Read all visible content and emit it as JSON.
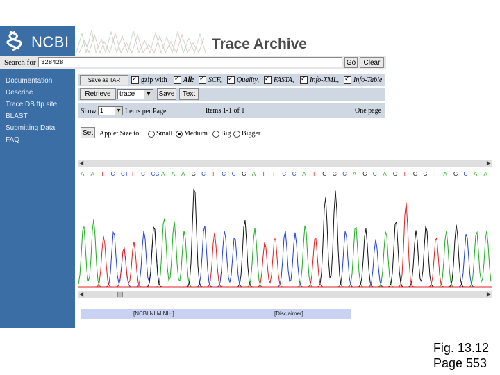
{
  "header": {
    "logo_text": "NCBI",
    "title": "Trace Archive"
  },
  "search": {
    "label": "Search for",
    "value": "328428",
    "go": "Go",
    "clear": "Clear"
  },
  "sidebar": {
    "items": [
      {
        "label": "Documentation"
      },
      {
        "label": "Describe"
      },
      {
        "label": "Trace DB ftp site"
      },
      {
        "label": "BLAST"
      },
      {
        "label": "Submitting Data"
      },
      {
        "label": "FAQ"
      }
    ]
  },
  "toolbar": {
    "save_tar": "Save as TAR",
    "gzip": "gzip with",
    "all": "All:",
    "scf": "SCF,",
    "quality": "Quality,",
    "fasta": "FASTA,",
    "info_xml": "Info-XML,",
    "info_table": "Info-Table",
    "retrieve": "Retrieve",
    "select_value": "trace",
    "save": "Save",
    "text": "Text",
    "show": "Show",
    "show_value": "1",
    "items_per_page": "Items per Page",
    "items_count": "Items 1-1 of 1",
    "one_page": "One page",
    "set": "Set",
    "applet_size": "Applet Size to:",
    "small": "Small",
    "medium": "Medium",
    "big": "Big",
    "bigger": "Bigger"
  },
  "chromatogram": {
    "colors": {
      "A": "#22aa22",
      "C": "#1f3fd6",
      "G": "#111111",
      "T": "#e02020"
    },
    "bases": [
      "A",
      "A",
      "T",
      "C",
      "CT",
      "T",
      "C",
      "CG",
      "A",
      "A",
      "A",
      "G",
      "C",
      "T",
      "C",
      "C",
      "G",
      "A",
      "T",
      "T",
      "C",
      "C",
      "A",
      "T",
      "G",
      "G",
      "C",
      "A",
      "G",
      "C",
      "A",
      "G",
      "T",
      "G",
      "G",
      "T",
      "A",
      "G",
      "C",
      "A",
      "A"
    ]
  },
  "footer": {
    "ncbi": "[NCBI NLM NIH]",
    "disclaimer": "[Disclaimer]"
  },
  "caption": {
    "line1": "Fig. 13.12",
    "line2": "Page 553"
  }
}
